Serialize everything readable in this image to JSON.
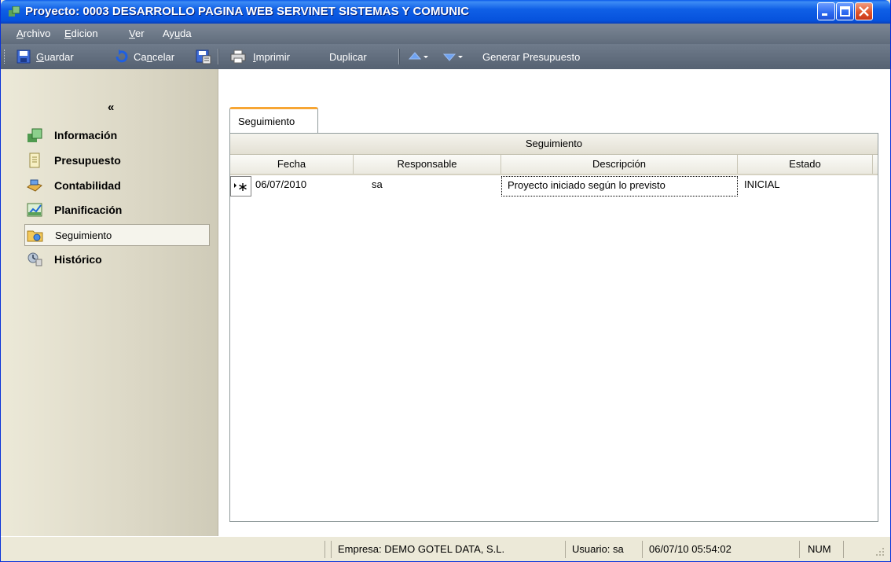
{
  "window": {
    "title": "Proyecto: 0003 DESARROLLO PAGINA WEB SERVINET SISTEMAS Y COMUNIC"
  },
  "menu": [
    {
      "accel": "A",
      "rest": "rchivo"
    },
    {
      "accel": "E",
      "rest": "dicion"
    },
    {
      "accel": "V",
      "rest": "er"
    },
    {
      "pre": "Ay",
      "accel": "u",
      "rest": "da"
    }
  ],
  "toolbar": {
    "guardar": {
      "accel": "G",
      "rest": "uardar"
    },
    "cancelar": {
      "pre": "Ca",
      "accel": "n",
      "rest": "celar"
    },
    "imprimir": {
      "accel": "I",
      "rest": "mprimir"
    },
    "duplicar": "Duplicar",
    "generar": "Generar Presupuesto"
  },
  "sidebar": {
    "collapse": "«",
    "items": [
      {
        "label": "Información",
        "icon": "info-icon"
      },
      {
        "label": "Presupuesto",
        "icon": "document-icon"
      },
      {
        "label": "Contabilidad",
        "icon": "accounting-icon"
      },
      {
        "label": "Planificación",
        "icon": "chart-icon"
      },
      {
        "label": "Seguimiento",
        "icon": "folder-icon",
        "active": true
      },
      {
        "label": "Histórico",
        "icon": "history-icon"
      }
    ]
  },
  "tab": {
    "label": "Seguimiento"
  },
  "grid": {
    "group_header": "Seguimiento",
    "columns": [
      "Fecha",
      "Responsable",
      "Descripción",
      "Estado"
    ],
    "rows": [
      {
        "fecha": "06/07/2010",
        "responsable": "sa",
        "descripcion": "Proyecto iniciado según lo previsto",
        "estado": "INICIAL"
      }
    ]
  },
  "status": {
    "empresa": "Empresa: DEMO GOTEL DATA, S.L.",
    "usuario": "Usuario: sa",
    "fecha": "06/07/10 05:54:02",
    "num": "NUM"
  }
}
